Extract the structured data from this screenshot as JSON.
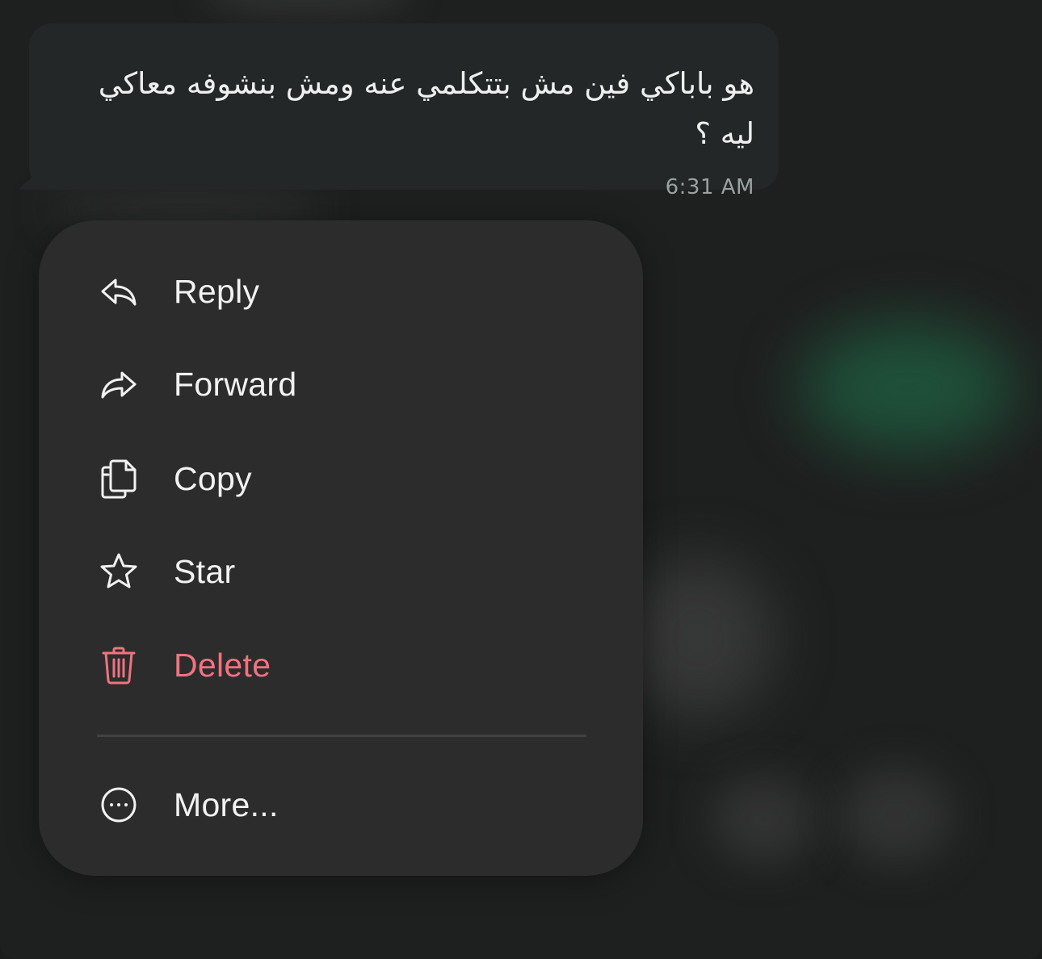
{
  "message": {
    "text": "هو باباكي فين مش بتتكلمي عنه ومش بنشوفه معاكي ليه ؟",
    "time": "6:31 AM"
  },
  "menu": {
    "items": [
      {
        "label": "Reply",
        "icon": "reply-icon"
      },
      {
        "label": "Forward",
        "icon": "forward-icon"
      },
      {
        "label": "Copy",
        "icon": "copy-icon"
      },
      {
        "label": "Star",
        "icon": "star-icon"
      },
      {
        "label": "Delete",
        "icon": "trash-icon",
        "destructive": true
      }
    ],
    "more": {
      "label": "More...",
      "icon": "more-icon"
    }
  },
  "colors": {
    "background": "#1e1f1f",
    "bubble": "#242727",
    "menu": "#2c2c2c",
    "text": "#f2f2f2",
    "danger": "#f0737f",
    "timestamp": "#9ba1a1"
  }
}
